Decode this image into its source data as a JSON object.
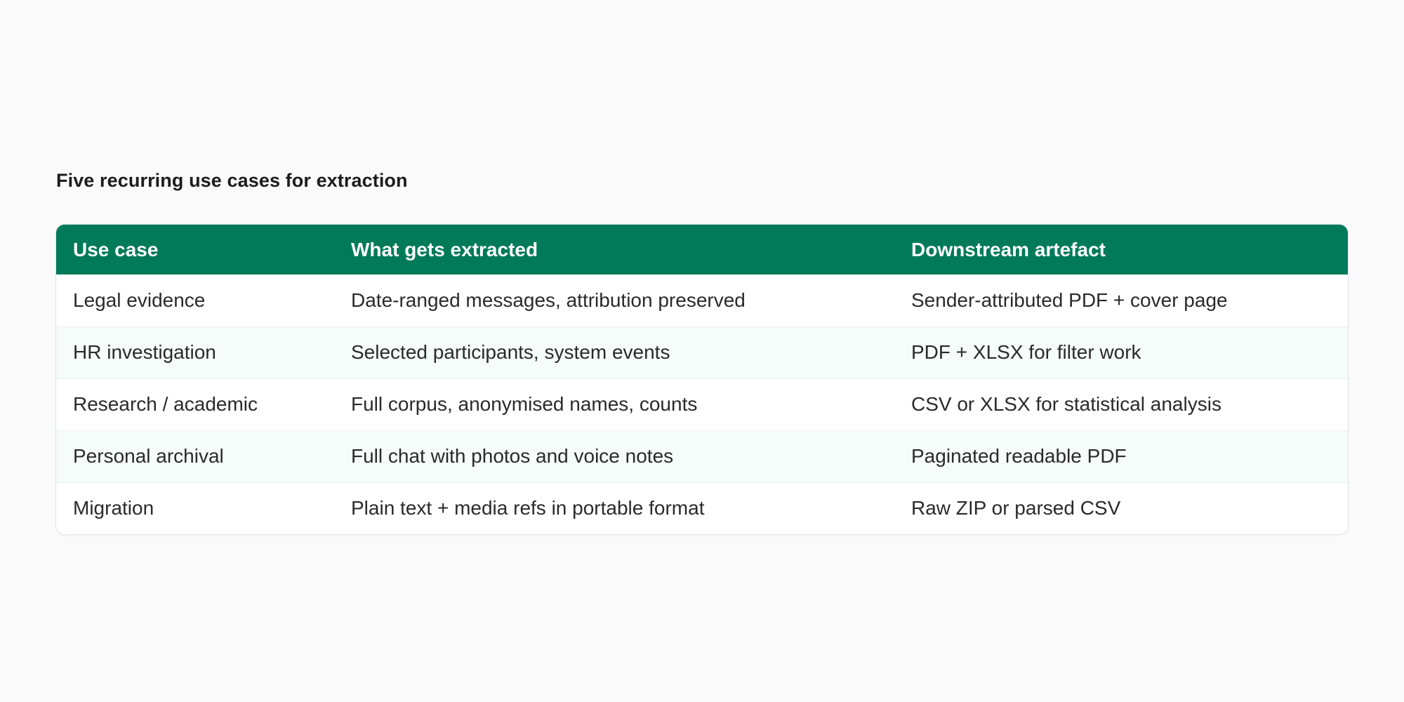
{
  "caption": "Five recurring use cases for extraction",
  "table": {
    "headers": [
      "Use case",
      "What gets extracted",
      "Downstream artefact"
    ],
    "rows": [
      [
        "Legal evidence",
        "Date-ranged messages, attribution preserved",
        "Sender-attributed PDF + cover page"
      ],
      [
        "HR investigation",
        "Selected participants, system events",
        "PDF + XLSX for filter work"
      ],
      [
        "Research / academic",
        "Full corpus, anonymised names, counts",
        "CSV or XLSX for statistical analysis"
      ],
      [
        "Personal archival",
        "Full chat with photos and voice notes",
        "Paginated readable PDF"
      ],
      [
        "Migration",
        "Plain text + media refs in portable format",
        "Raw ZIP or parsed CSV"
      ]
    ]
  },
  "colors": {
    "header_bg": "#007a58",
    "header_text": "#ffffff",
    "alt_row_bg": "#f5fcf9",
    "page_bg": "#fafafa"
  }
}
